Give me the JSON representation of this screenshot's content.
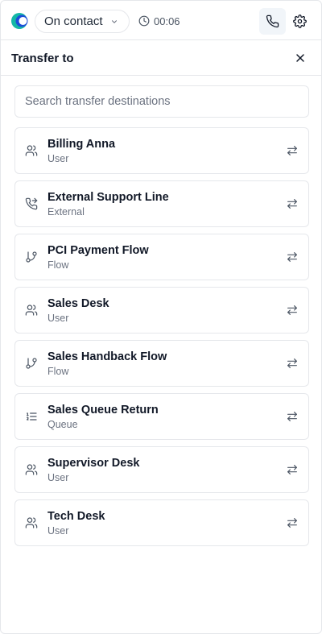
{
  "topbar": {
    "status_label": "On contact",
    "timer": "00:06",
    "brand_colors": [
      "#0ea5a4",
      "#1d4ed8"
    ]
  },
  "panel": {
    "title": "Transfer to"
  },
  "search": {
    "placeholder": "Search transfer destinations",
    "value": ""
  },
  "destinations": [
    {
      "name": "Billing Anna",
      "type": "User",
      "icon": "users-icon"
    },
    {
      "name": "External Support Line",
      "type": "External",
      "icon": "phone-forward-icon"
    },
    {
      "name": "PCI Payment Flow",
      "type": "Flow",
      "icon": "git-branch-icon"
    },
    {
      "name": "Sales Desk",
      "type": "User",
      "icon": "users-icon"
    },
    {
      "name": "Sales Handback Flow",
      "type": "Flow",
      "icon": "git-branch-icon"
    },
    {
      "name": "Sales Queue Return",
      "type": "Queue",
      "icon": "list-ordered-icon"
    },
    {
      "name": "Supervisor Desk",
      "type": "User",
      "icon": "users-icon"
    },
    {
      "name": "Tech Desk",
      "type": "User",
      "icon": "users-icon"
    }
  ]
}
